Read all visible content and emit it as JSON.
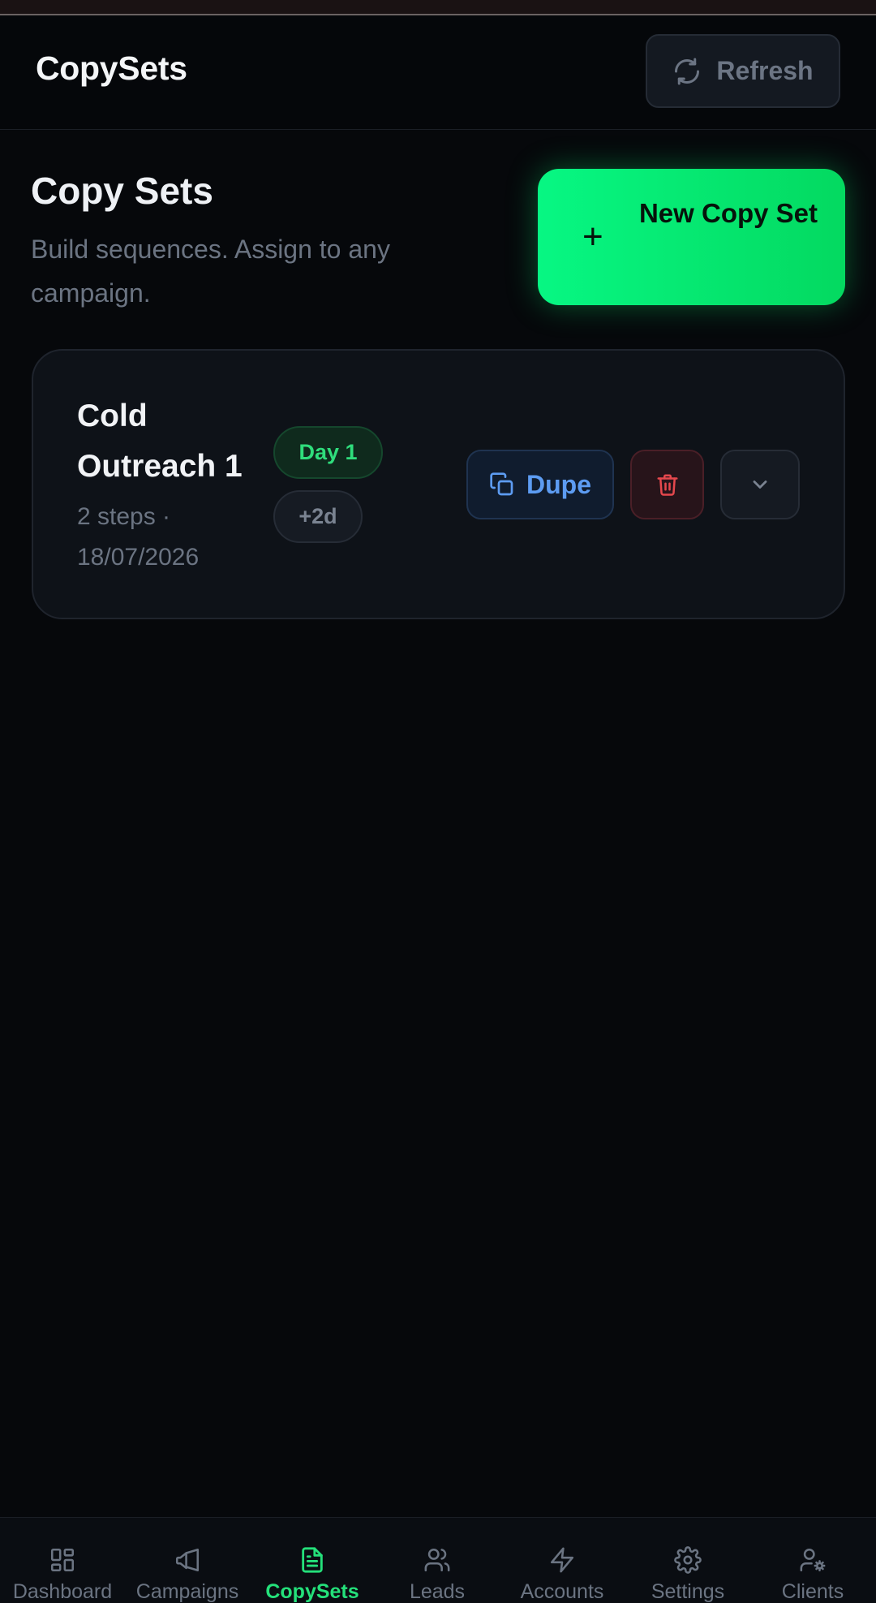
{
  "header": {
    "title": "CopySets",
    "refresh_label": "Refresh"
  },
  "page": {
    "title": "Copy Sets",
    "subtitle": "Build sequences. Assign to any campaign.",
    "new_button_label": "New Copy Set",
    "new_button_icon": "plus-icon"
  },
  "copy_sets": [
    {
      "name": "Cold Outreach 1",
      "meta": "2 steps · 18/07/2026",
      "badges": [
        "Day 1",
        "+2d"
      ],
      "actions": {
        "dupe_label": "Dupe",
        "dupe_icon": "copy-icon",
        "delete_icon": "trash-icon",
        "expand_icon": "chevron-down-icon"
      }
    }
  ],
  "nav": {
    "active": "CopySets",
    "items": [
      {
        "label": "Dashboard",
        "icon": "dashboard-icon"
      },
      {
        "label": "Campaigns",
        "icon": "megaphone-icon"
      },
      {
        "label": "CopySets",
        "icon": "document-icon"
      },
      {
        "label": "Leads",
        "icon": "users-icon"
      },
      {
        "label": "Accounts",
        "icon": "lightning-icon"
      },
      {
        "label": "Settings",
        "icon": "gear-icon"
      },
      {
        "label": "Clients",
        "icon": "user-gear-icon"
      }
    ]
  },
  "colors": {
    "background": "#06080b",
    "accent": "#07f783",
    "active_nav": "#24e07a",
    "dupe": "#5d9cf2",
    "delete": "#e5484d",
    "muted_text": "#6b7482"
  }
}
